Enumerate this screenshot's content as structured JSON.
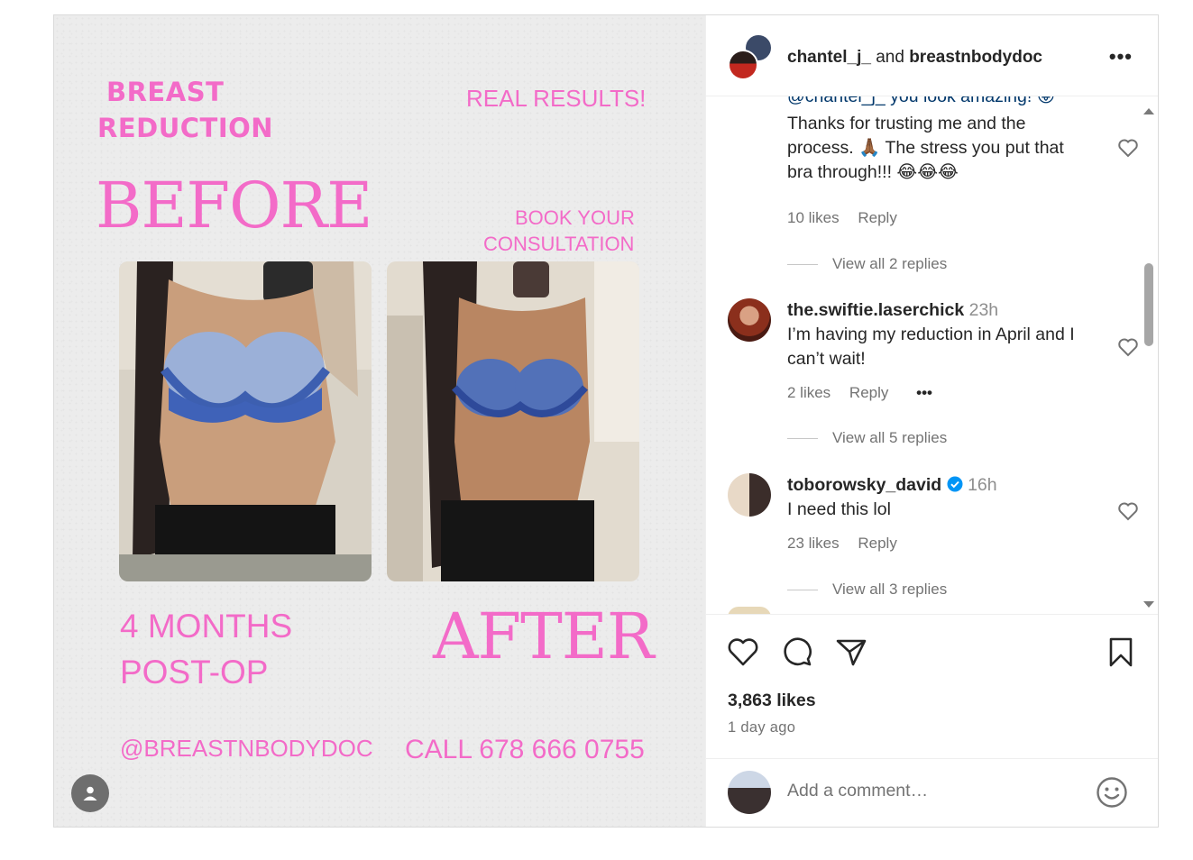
{
  "post_image": {
    "title_line1": "BREAST",
    "title_line2": "REDUCTION",
    "real_results": "REAL RESULTS!",
    "before": "BEFORE",
    "book_line1": "BOOK YOUR",
    "book_line2": "CONSULTATION",
    "months_line1": "4 MONTHS",
    "months_line2": "POST-OP",
    "after": "AFTER",
    "handle": "@BREASTNBODYDOC",
    "phone": "CALL 678 666 0755"
  },
  "header": {
    "user1": "chantel_j_",
    "and": "and",
    "user2": "breastnbodydoc",
    "more": "•••"
  },
  "comments": [
    {
      "partial_top": "@chantel_j_ you look amazing! 😜",
      "text": "Thanks for trusting me and the process. 🙏🏾 The stress you put that bra through!!! 😂😂😂",
      "likes": "10 likes",
      "reply": "Reply",
      "view_replies": "View all 2 replies"
    },
    {
      "user": "the.swiftie.laserchick",
      "time": "23h",
      "text": "I’m having my reduction in April and I can’t wait!",
      "likes": "2 likes",
      "reply": "Reply",
      "more": "•••",
      "view_replies": "View all 5 replies"
    },
    {
      "user": "toborowsky_david",
      "time": "16h",
      "text": "I need this lol",
      "likes": "23 likes",
      "reply": "Reply",
      "view_replies": "View all 3 replies"
    }
  ],
  "actions": {
    "likes": "3,863 likes",
    "time_ago": "1 day ago"
  },
  "add_comment": {
    "placeholder": "Add a comment…"
  },
  "colors": {
    "pink": "#f36bc8",
    "verified": "#0095f6"
  }
}
